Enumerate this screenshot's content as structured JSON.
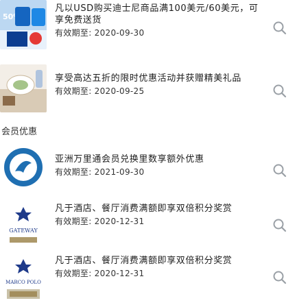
{
  "offers": [
    {
      "title": "凡以USD购买迪士尼商品满100美元/60美元，可享免费送货",
      "expiry_label": "有效期至:",
      "expiry_date": "2020-09-30",
      "thumb": "disney-sale-image"
    },
    {
      "title": "享受高达五折的限时优惠活动并获赠精美礼品",
      "expiry_label": "有效期至:",
      "expiry_date": "2020-09-25",
      "thumb": "dining-table-image"
    }
  ],
  "section_title": "会员优惠",
  "member_offers": [
    {
      "title": "亚洲万里通会员兑换里数享额外优惠",
      "expiry_label": "有效期至:",
      "expiry_date": "2021-09-30",
      "thumb": "asia-miles-logo"
    },
    {
      "title": "凡于酒店、餐厅消费满额即享双倍积分奖赏",
      "expiry_label": "有效期至:",
      "expiry_date": "2020-12-31",
      "thumb": "gateway-hotel-logo",
      "thumb_caption": "GATEWAY"
    },
    {
      "title": "凡于酒店、餐厅消费满额即享双倍积分奖赏",
      "expiry_label": "有效期至:",
      "expiry_date": "2020-12-31",
      "thumb": "marco-polo-hotel-logo",
      "thumb_caption": "MARCO POLO"
    }
  ],
  "colors": {
    "accent_blue": "#1e3a8a",
    "gold": "#8a6d2b",
    "icon_gray": "#9aa0a6"
  }
}
